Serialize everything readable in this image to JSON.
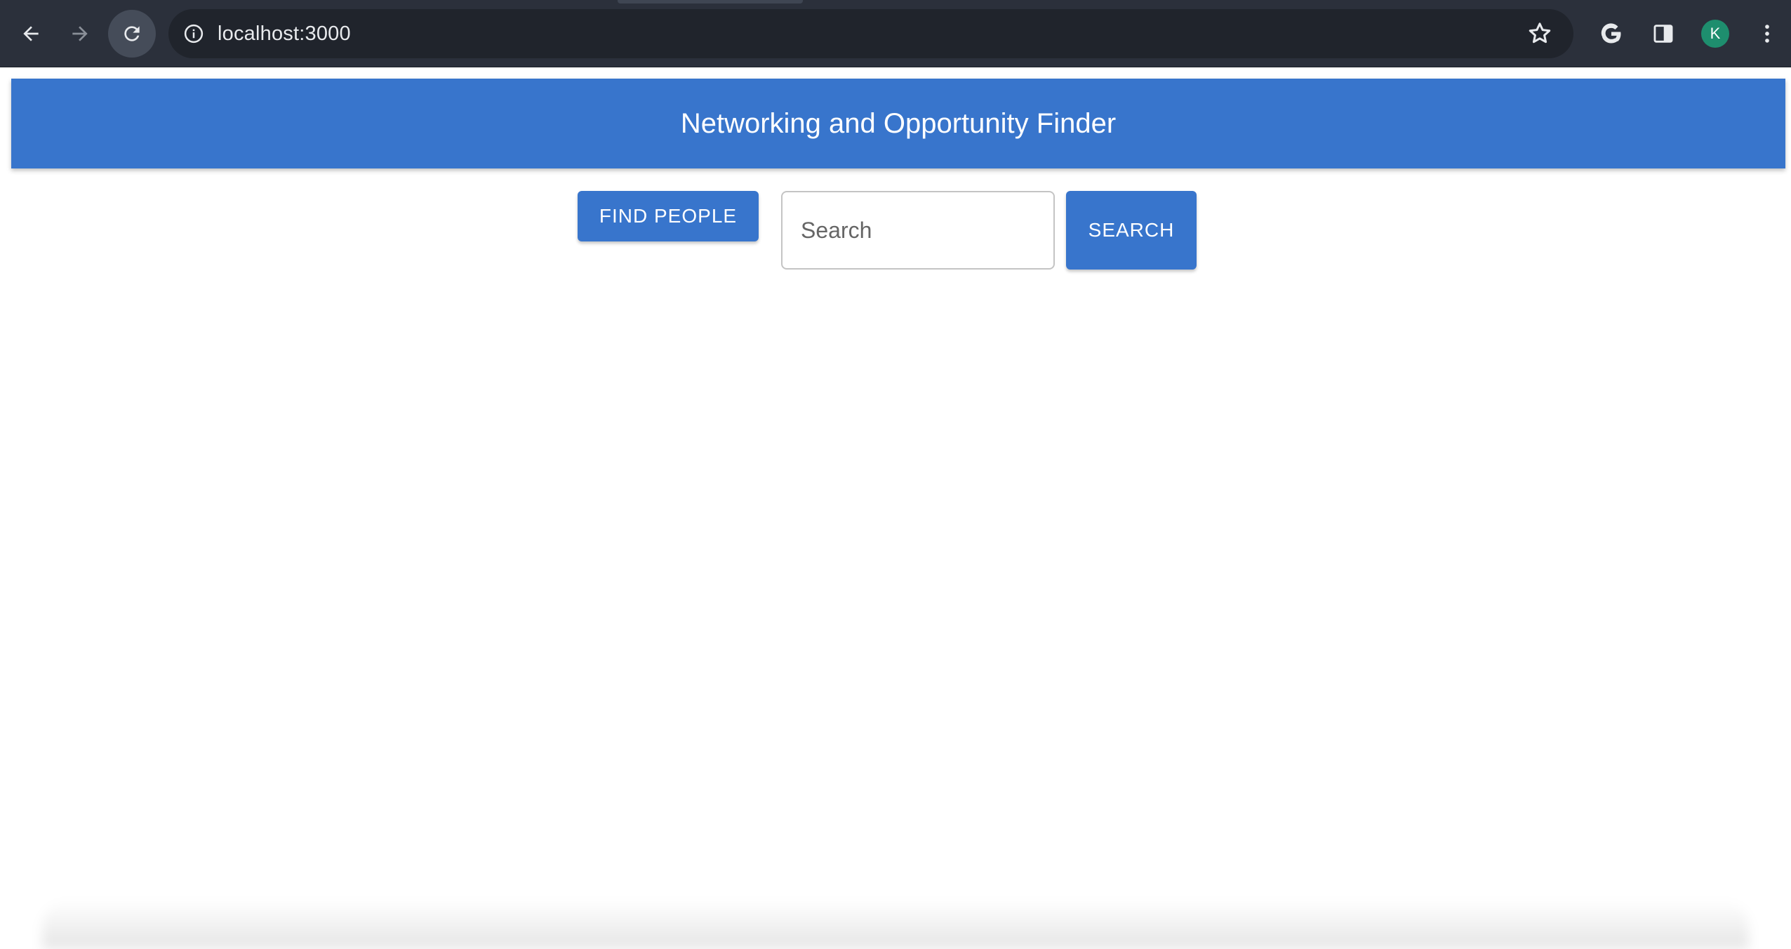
{
  "browser": {
    "url": "localhost:3000",
    "avatar_letter": "K",
    "icons": [
      "back-arrow-icon",
      "forward-arrow-icon",
      "reload-icon",
      "info-icon",
      "star-icon",
      "google-icon",
      "side-panel-icon",
      "kebab-menu-icon"
    ]
  },
  "header": {
    "title": "Networking and Opportunity Finder"
  },
  "toolbar": {
    "find_people_label": "FIND PEOPLE",
    "search_placeholder": "Search",
    "search_value": "",
    "search_button_label": "SEARCH"
  },
  "colors": {
    "accent": "#3875cc",
    "chrome_bg": "#2b303b",
    "omnibox_bg": "#20242c",
    "avatar_bg": "#1e8e6e"
  }
}
